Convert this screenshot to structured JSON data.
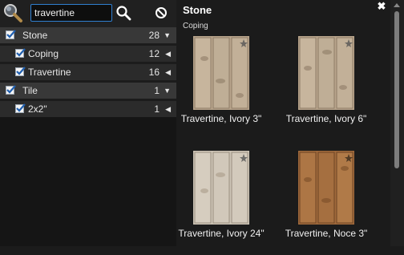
{
  "search": {
    "value": "travertine"
  },
  "filters": [
    {
      "type": "category",
      "label": "Stone",
      "count": "28",
      "arrow": "▼",
      "checked": true
    },
    {
      "type": "sub",
      "label": "Coping",
      "count": "12",
      "arrow": "◀",
      "checked": true
    },
    {
      "type": "sub",
      "label": "Travertine",
      "count": "16",
      "arrow": "◀",
      "checked": true
    },
    {
      "type": "category",
      "label": "Tile",
      "count": "1",
      "arrow": "▼",
      "checked": true
    },
    {
      "type": "sub",
      "label": "2x2\"",
      "count": "1",
      "arrow": "◀",
      "checked": true
    }
  ],
  "results": {
    "title": "Stone",
    "close_symbol": "✖",
    "section": "Coping",
    "items": [
      {
        "label": "Travertine, Ivory 3\"",
        "tone": "ivory"
      },
      {
        "label": "Travertine, Ivory 6\"",
        "tone": "ivory"
      },
      {
        "label": "Travertine, Ivory 24\"",
        "tone": "pale"
      },
      {
        "label": "Travertine, Noce 3\"",
        "tone": "noce"
      }
    ]
  },
  "colors": {
    "accent": "#2f7fd0",
    "ivory": "#b9a58c",
    "pale": "#cdc4b6",
    "noce": "#a06a3c"
  }
}
